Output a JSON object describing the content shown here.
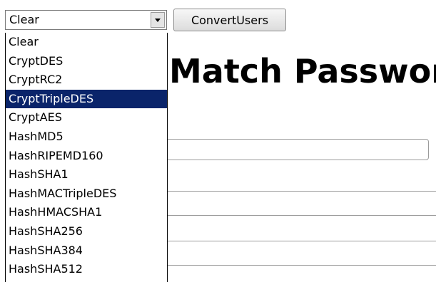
{
  "select": {
    "value": "Clear",
    "options": [
      "Clear",
      "CryptDES",
      "CryptRC2",
      "CryptTripleDES",
      "CryptAES",
      "HashMD5",
      "HashRIPEMD160",
      "HashSHA1",
      "HashMACTripleDES",
      "HashHMACSHA1",
      "HashSHA256",
      "HashSHA384",
      "HashSHA512"
    ],
    "highlighted_option": "CryptTripleDES"
  },
  "convert_button": {
    "label": "ConvertUsers"
  },
  "heading": {
    "text": "Match Passwor"
  },
  "colors": {
    "highlight_bg": "#0a246a",
    "highlight_fg": "#ffffff"
  }
}
